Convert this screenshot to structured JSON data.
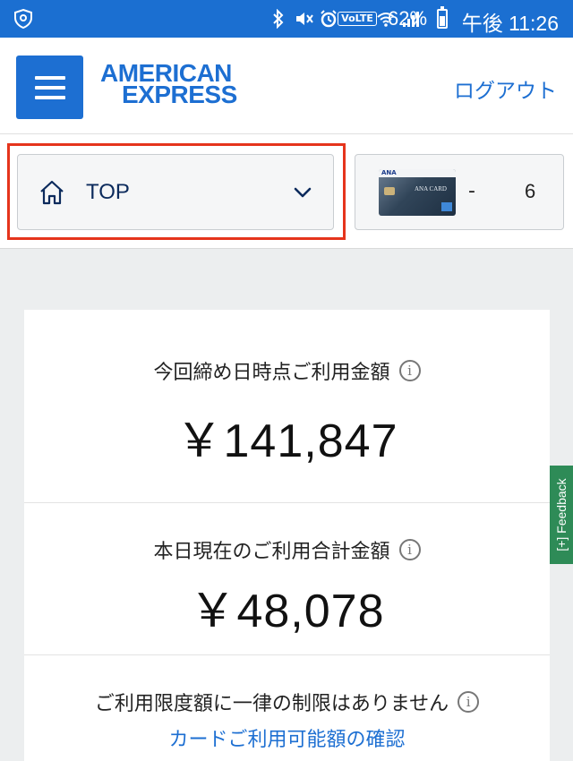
{
  "status_bar": {
    "battery": "62%",
    "time": "午後 11:26",
    "icons": [
      "shield-icon",
      "bluetooth-icon",
      "mute-icon",
      "alarm-icon",
      "volte-icon",
      "wifi-icon",
      "signal-icon",
      "battery-icon"
    ],
    "volte_label": "VoLTE",
    "background": "#1b6fd1"
  },
  "header": {
    "logo_line1": "AMERICAN",
    "logo_line2": "EXPRESS",
    "logout_label": "ログアウト",
    "brand_color": "#1d6fd2"
  },
  "nav_select": {
    "label": "TOP",
    "icon": "home-icon"
  },
  "card_select": {
    "card_name": "ANA CARD",
    "dash": "-",
    "suffix": "6"
  },
  "summary": {
    "closing": {
      "title": "今回締め日時点ご利用金額",
      "amount": "￥141,847"
    },
    "today": {
      "title": "本日現在のご利用合計金額",
      "amount": "￥48,078"
    },
    "limit": {
      "title": "ご利用限度額に一律の制限はありません",
      "link": "カードご利用可能額の確認"
    }
  },
  "feedback": {
    "label": "[+] Feedback",
    "color": "#2e8b57"
  },
  "highlight_color": "#e5341c"
}
